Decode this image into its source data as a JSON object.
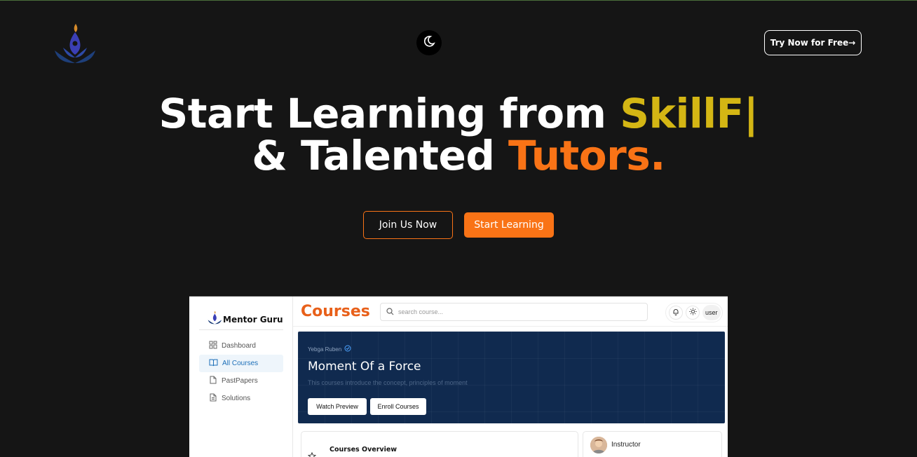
{
  "header": {
    "logo_icon": "lotus-flame-logo-icon",
    "theme_toggle_icon": "moon-stars-icon",
    "cta_label": "Try Now for Free",
    "cta_arrow": "→"
  },
  "hero": {
    "line1_prefix": "Start Learning from ",
    "line1_highlight": "SkillF",
    "line1_caret": "|",
    "line2_prefix": "& Talented ",
    "line2_highlight": "Tutors.",
    "highlight_colors": {
      "yellow": "#d4b614",
      "orange": "#f97316"
    }
  },
  "actions": {
    "join_label": "Join Us Now",
    "start_label": "Start Learning"
  },
  "preview": {
    "brand_name": "Mentor Guru",
    "nav": [
      {
        "label": "Dashboard",
        "icon": "grid-icon",
        "active": false
      },
      {
        "label": "All Courses",
        "icon": "book-open-icon",
        "active": true
      },
      {
        "label": "PastPapers",
        "icon": "file-icon",
        "active": false
      },
      {
        "label": "Solutions",
        "icon": "file-text-icon",
        "active": false
      }
    ],
    "page_title": "Courses",
    "search_placeholder": "search course...",
    "user_label": "user",
    "banner": {
      "author": "Yebga Ruben",
      "title": "Moment Of a Force",
      "description": "This courses introduce the concept, principles of moment",
      "watch_label": "Watch Preview",
      "enroll_label": "Enroll Courses"
    },
    "overview_title": "Courses Overview",
    "instructor_label": "Instructor"
  }
}
